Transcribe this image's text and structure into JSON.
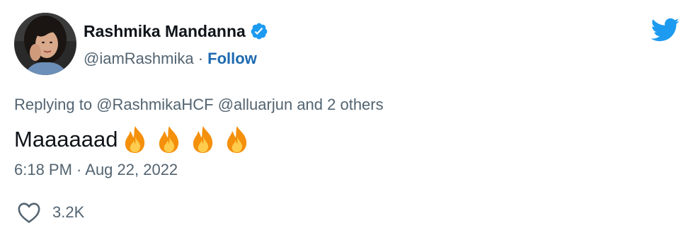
{
  "author": {
    "display_name": "Rashmika Mandanna",
    "handle": "@iamRashmika",
    "separator": "·",
    "follow_label": "Follow",
    "verified_icon": "verified-badge-icon",
    "avatar_icon": "avatar"
  },
  "brand": {
    "logo_icon": "twitter-bird-icon",
    "accent_color": "#1d9bf0"
  },
  "reply": {
    "prefix": "Replying to",
    "mentions": [
      "@RashmikaHCF",
      "@alluarjun"
    ],
    "suffix": "and 2 others"
  },
  "tweet": {
    "text": "Maaaaaad",
    "emoji_icon": "fire-emoji-icon",
    "emoji_count": 4
  },
  "meta": {
    "timestamp": "6:18 PM · Aug 22, 2022"
  },
  "engagement": {
    "likes_icon": "heart-icon",
    "likes_count": "3.2K"
  }
}
